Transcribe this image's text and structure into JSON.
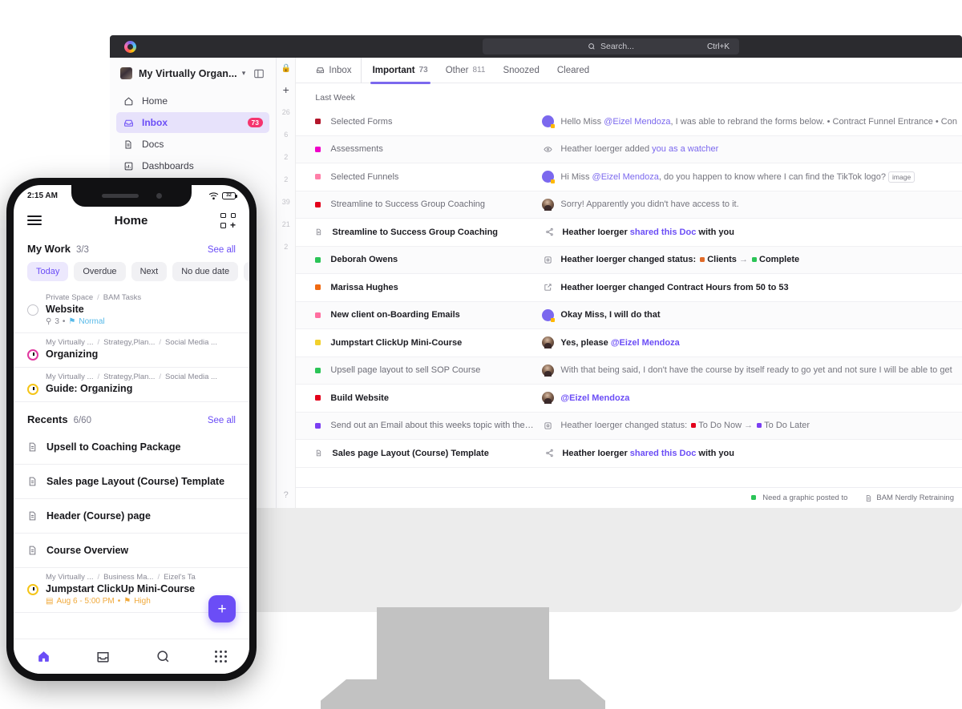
{
  "topbar": {
    "search_placeholder": "Search...",
    "search_shortcut": "Ctrl+K",
    "logo": "clickup-logo"
  },
  "sidebar": {
    "workspace_name": "My Virtually Organ...",
    "items": [
      {
        "label": "Home",
        "icon": "home-icon",
        "badge": ""
      },
      {
        "label": "Inbox",
        "icon": "inbox-icon",
        "badge": "73"
      },
      {
        "label": "Docs",
        "icon": "doc-icon",
        "badge": ""
      },
      {
        "label": "Dashboards",
        "icon": "dashboard-icon",
        "badge": ""
      }
    ]
  },
  "rail": {
    "numbers": [
      "26",
      "6",
      "2",
      "2",
      "39",
      "21",
      "2"
    ],
    "plus": "+"
  },
  "tabs": [
    {
      "label": "Inbox",
      "count": "",
      "active": false,
      "icon": "inbox-icon"
    },
    {
      "label": "Important",
      "count": "73",
      "active": true
    },
    {
      "label": "Other",
      "count": "811",
      "active": false
    },
    {
      "label": "Snoozed",
      "count": "",
      "active": false
    },
    {
      "label": "Cleared",
      "count": "",
      "active": false
    }
  ],
  "inbox": {
    "section_label": "Last Week",
    "rows": [
      {
        "dot": "#b3162b",
        "title": "Selected Forms",
        "unread": false,
        "mid": "avatar-purple",
        "msg_pre": "Hello Miss ",
        "msg_link": "@Eizel Mendoza",
        "msg_post": ", I was able to rebrand the forms below.  • Contract Funnel Entrance  • Con"
      },
      {
        "dot": "#ef00c8",
        "title": "Assessments",
        "unread": false,
        "mid": "eye-icon",
        "msg_pre": "Heather Ioerger added ",
        "msg_link": "you as a watcher",
        "msg_post": ""
      },
      {
        "dot": "#ff7fa8",
        "title": "Selected Funnels",
        "unread": false,
        "mid": "avatar-purple",
        "msg_pre": "Hi Miss ",
        "msg_link": "@Eizel Mendoza",
        "msg_post": ", do you happen to know where I can find the TikTok logo?",
        "chip": "image"
      },
      {
        "dot": "#e3001b",
        "title": "Streamline to Success Group Coaching",
        "unread": false,
        "mid": "avatar-photo",
        "msg_pre": "Sorry! Apparently you didn't have access to it.",
        "msg_link": "",
        "msg_post": ""
      },
      {
        "dot": "doc",
        "title": "Streamline to Success Group Coaching",
        "unread": true,
        "mid": "share-icon",
        "msg_pre": "Heather Ioerger ",
        "msg_link": "shared this Doc",
        "msg_post": " with you"
      },
      {
        "dot": "#2bc457",
        "title": "Deborah Owens",
        "unread": true,
        "mid": "status-icon",
        "msg_pre": "Heather Ioerger changed status: ",
        "status_from": "Clients",
        "status_from_color": "#e06a28",
        "status_to": "Complete",
        "status_to_color": "#2bc457"
      },
      {
        "dot": "#f06a12",
        "title": "Marissa Hughes",
        "unread": true,
        "mid": "edit-icon",
        "msg_pre": "Heather Ioerger changed Contract Hours from 50 to 53",
        "msg_link": "",
        "msg_post": ""
      },
      {
        "dot": "#ff6fa0",
        "title": "New client on-Boarding Emails",
        "unread": true,
        "mid": "avatar-purple",
        "msg_pre": "Okay Miss, I will do that",
        "msg_link": "",
        "msg_post": ""
      },
      {
        "dot": "#f2d02c",
        "title": "Jumpstart ClickUp Mini-Course",
        "unread": true,
        "mid": "avatar-photo",
        "msg_pre": "Yes, please ",
        "msg_link": "@Eizel Mendoza",
        "msg_post": ""
      },
      {
        "dot": "#2bc457",
        "title": "Upsell page layout to sell SOP Course",
        "unread": false,
        "mid": "avatar-photo",
        "msg_pre": "With that being said, I don't have the course by itself ready to go yet and not sure I will be able to get",
        "msg_link": "",
        "msg_post": ""
      },
      {
        "dot": "#e3001b",
        "title": "Build Website",
        "unread": true,
        "mid": "avatar-photo",
        "msg_pre": "",
        "msg_link": "@Eizel Mendoza",
        "msg_post": ""
      },
      {
        "dot": "#7b3ff2",
        "title": "Send out an Email about this weeks topic with the blog",
        "unread": false,
        "mid": "status-icon",
        "msg_pre": "Heather Ioerger changed status: ",
        "status_from": "To Do Now",
        "status_from_color": "#e3001b",
        "status_to": "To Do Later",
        "status_to_color": "#7b3ff2"
      },
      {
        "dot": "doc",
        "title": "Sales page Layout (Course) Template",
        "unread": true,
        "mid": "share-icon",
        "msg_pre": "Heather Ioerger ",
        "msg_link": "shared this Doc",
        "msg_post": " with you"
      }
    ],
    "footer": [
      {
        "type": "dot",
        "color": "#2bc457",
        "label": "Need a graphic posted to"
      },
      {
        "type": "doc",
        "label": "BAM Nerdly Retraining"
      }
    ]
  },
  "phone": {
    "status_time": "2:15 AM",
    "battery": "32",
    "header_title": "Home",
    "my_work": {
      "title": "My Work",
      "count": "3/3",
      "see_all": "See all"
    },
    "filters": [
      {
        "label": "Today",
        "active": true
      },
      {
        "label": "Overdue",
        "active": false
      },
      {
        "label": "Next",
        "active": false
      },
      {
        "label": "No due date",
        "active": false
      }
    ],
    "tasks": [
      {
        "marker": "check",
        "crumbs": [
          "Private Space",
          "BAM Tasks"
        ],
        "name": "Website",
        "meta_count": "3",
        "meta_sep": "•",
        "priority": "Normal"
      },
      {
        "marker": "clock-pink",
        "crumbs": [
          "My Virtually ...",
          "Strategy,Plan...",
          "Social Media ..."
        ],
        "name": "Organizing",
        "meta_count": "",
        "priority": ""
      },
      {
        "marker": "clock-yellow",
        "crumbs": [
          "My Virtually ...",
          "Strategy,Plan...",
          "Social Media ..."
        ],
        "name": "Guide: Organizing",
        "meta_count": "",
        "priority": ""
      }
    ],
    "recents": {
      "title": "Recents",
      "count": "6/60",
      "see_all": "See all",
      "items": [
        "Upsell to Coaching Package",
        "Sales page Layout (Course) Template",
        "Header (Course) page",
        "Course Overview"
      ]
    },
    "last_task": {
      "marker": "clock-yellow",
      "crumbs": [
        "My Virtually ...",
        "Business Ma...",
        "Eizel's Ta"
      ],
      "name": "Jumpstart ClickUp Mini-Course",
      "due": "Aug 6 - 5:00 PM",
      "priority": "High"
    },
    "fab": "+",
    "tabbar": [
      {
        "icon": "home-icon",
        "active": true
      },
      {
        "icon": "inbox-icon",
        "active": false
      },
      {
        "icon": "search-icon",
        "active": false
      },
      {
        "icon": "apps-grid-icon",
        "active": false
      }
    ]
  }
}
